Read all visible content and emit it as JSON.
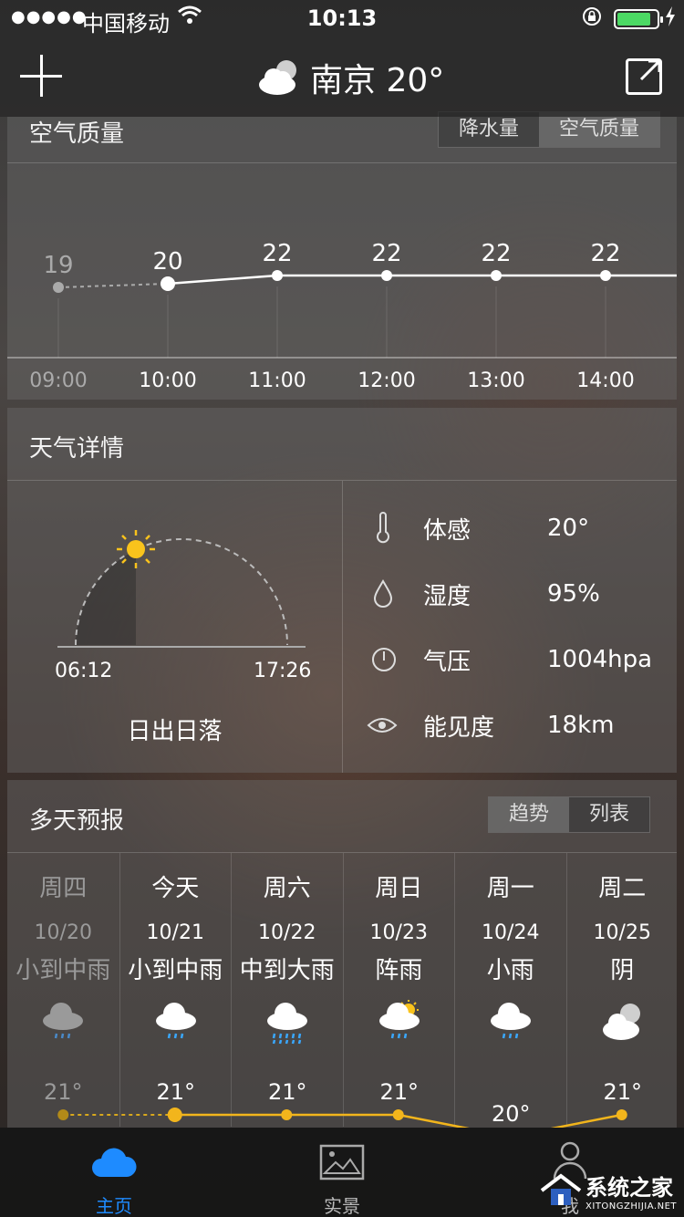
{
  "status_bar": {
    "signal": "●●●●●",
    "carrier": "中国移动",
    "time": "10:13"
  },
  "header": {
    "city_temp": "南京 20°"
  },
  "air_quality": {
    "title": "空气质量",
    "tabs": [
      "降水量",
      "空气质量"
    ],
    "active_tab": 1
  },
  "hourly": {
    "temps": [
      19,
      20,
      22,
      22,
      22,
      22
    ],
    "times": [
      "09:00",
      "10:00",
      "11:00",
      "12:00",
      "13:00",
      "14:00"
    ]
  },
  "details": {
    "title": "天气详情",
    "sunrise": "06:12",
    "sunset": "17:26",
    "sun_label": "日出日落",
    "rows": [
      {
        "label": "体感",
        "value": "20°"
      },
      {
        "label": "湿度",
        "value": "95%"
      },
      {
        "label": "气压",
        "value": "1004hpa"
      },
      {
        "label": "能见度",
        "value": "18km"
      }
    ]
  },
  "forecast": {
    "title": "多天预报",
    "tabs": [
      "趋势",
      "列表"
    ],
    "active_tab": 0,
    "days": [
      {
        "day": "周四",
        "date": "10/20",
        "cond": "小到中雨",
        "high": "21°",
        "icon": "cloud-rain-dark-icon"
      },
      {
        "day": "今天",
        "date": "10/21",
        "cond": "小到中雨",
        "high": "21°",
        "icon": "cloud-rain-icon"
      },
      {
        "day": "周六",
        "date": "10/22",
        "cond": "中到大雨",
        "high": "21°",
        "icon": "cloud-heavy-rain-icon"
      },
      {
        "day": "周日",
        "date": "10/23",
        "cond": "阵雨",
        "high": "21°",
        "icon": "sun-cloud-rain-icon"
      },
      {
        "day": "周一",
        "date": "10/24",
        "cond": "小雨",
        "high": "20°",
        "icon": "cloud-rain-icon"
      },
      {
        "day": "周二",
        "date": "10/25",
        "cond": "阴",
        "high": "21°",
        "icon": "cloudy-icon"
      }
    ],
    "high_values": [
      21,
      21,
      21,
      21,
      20,
      21
    ]
  },
  "tabbar": {
    "items": [
      "主页",
      "实景",
      "我"
    ],
    "active": 0
  },
  "watermark": {
    "name": "系统之家",
    "url": "XITONGZHIJIA.NET"
  },
  "colors": {
    "accent_blue": "#1e8bff",
    "sun_yellow": "#f9c31c",
    "battery_green": "#4cd964",
    "trend_line": "#f2b51c"
  }
}
